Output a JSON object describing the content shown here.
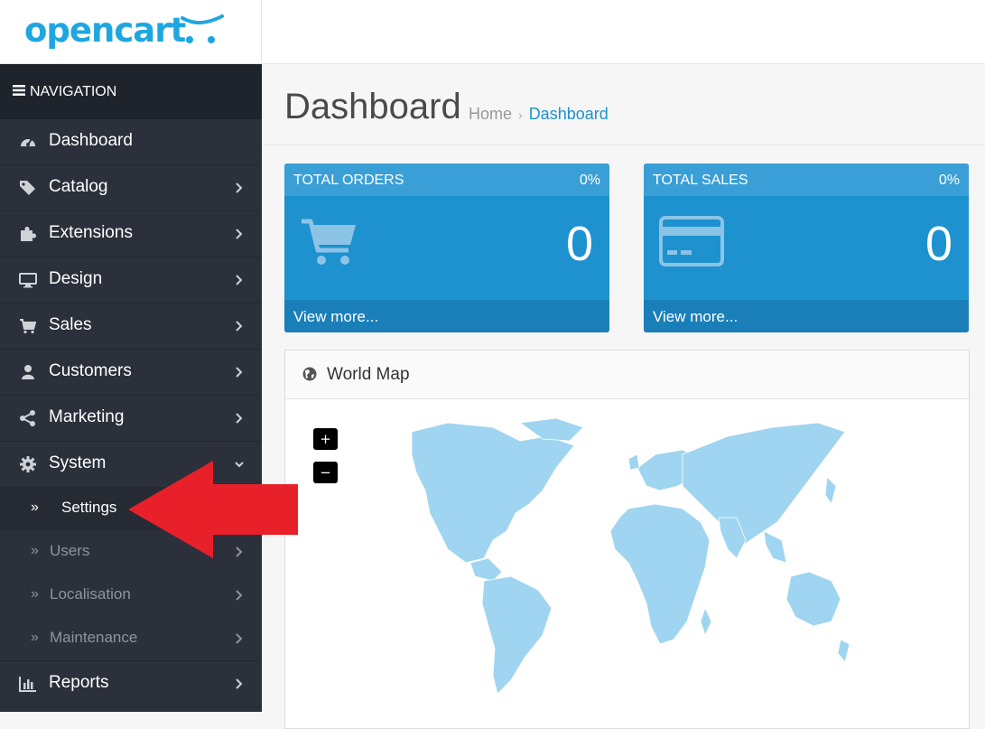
{
  "brand": {
    "logo_text": "opencart"
  },
  "nav": {
    "header": "NAVIGATION",
    "items": [
      {
        "label": "Dashboard",
        "icon": "dashboard-icon"
      },
      {
        "label": "Catalog",
        "icon": "tags-icon"
      },
      {
        "label": "Extensions",
        "icon": "puzzle-icon"
      },
      {
        "label": "Design",
        "icon": "desktop-icon"
      },
      {
        "label": "Sales",
        "icon": "cart-icon"
      },
      {
        "label": "Customers",
        "icon": "user-icon"
      },
      {
        "label": "Marketing",
        "icon": "share-icon"
      },
      {
        "label": "System",
        "icon": "gear-icon"
      }
    ],
    "system_sub": [
      {
        "label": "Settings"
      },
      {
        "label": "Users"
      },
      {
        "label": "Localisation"
      },
      {
        "label": "Maintenance"
      }
    ],
    "reports": {
      "label": "Reports",
      "icon": "bar-chart-icon"
    }
  },
  "header": {
    "title": "Dashboard",
    "breadcrumb": [
      "Home",
      "Dashboard"
    ]
  },
  "tiles": [
    {
      "title": "TOTAL ORDERS",
      "percent": "0%",
      "value": "0",
      "link": "View more...",
      "icon": "shopping-cart-icon"
    },
    {
      "title": "TOTAL SALES",
      "percent": "0%",
      "value": "0",
      "link": "View more...",
      "icon": "credit-card-icon"
    }
  ],
  "map_panel": {
    "title": "World Map",
    "zoom_in": "+",
    "zoom_out": "−"
  },
  "colors": {
    "accent": "#1e91cf",
    "sidebar": "#2b303b",
    "annotation_arrow": "#e8202a",
    "map_land": "#9fd5f0"
  }
}
